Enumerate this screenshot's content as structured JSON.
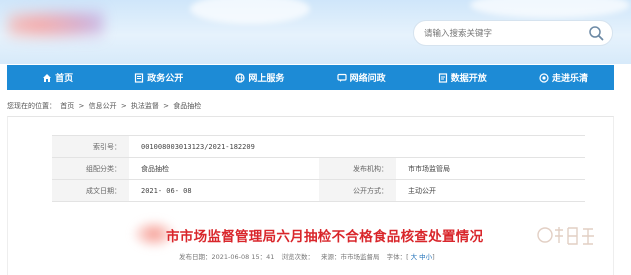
{
  "header": {
    "search_placeholder": "请输入搜索关键字"
  },
  "nav": {
    "items": [
      {
        "label": "首页",
        "icon": "home-icon"
      },
      {
        "label": "政务公开",
        "icon": "document-icon"
      },
      {
        "label": "网上服务",
        "icon": "globe-icon"
      },
      {
        "label": "网络问政",
        "icon": "chat-icon"
      },
      {
        "label": "数据开放",
        "icon": "data-icon"
      },
      {
        "label": "走进乐清",
        "icon": "eye-icon"
      }
    ],
    "color": "#1d8bd6"
  },
  "breadcrumb": {
    "prefix": "您现在的位置：",
    "items": [
      "首页",
      "信息公开",
      "执法监督",
      "食品抽检"
    ],
    "separator": ">"
  },
  "info": {
    "index_label": "索引号：",
    "index_value": "001008003013123/2021-182209",
    "category_label": "组配分类：",
    "category_value": "食品抽检",
    "publisher_label": "发布机构：",
    "publisher_value": "市市场监管局",
    "date_label": "成文日期：",
    "date_value": "2021- 06- 08",
    "public_label": "公开方式：",
    "public_value": "主动公开"
  },
  "article": {
    "title": "市市场监督管理局六月抽检不合格食品核查处置情况",
    "title_color": "#d9262b",
    "published": "发布日期：2021-06-08 15：41",
    "views": "浏览次数：",
    "source": "来源：市市场监督局",
    "font_prefix": "字体：[",
    "font_large": "大",
    "font_medium": "中",
    "font_small": "小",
    "font_suffix": "]"
  }
}
